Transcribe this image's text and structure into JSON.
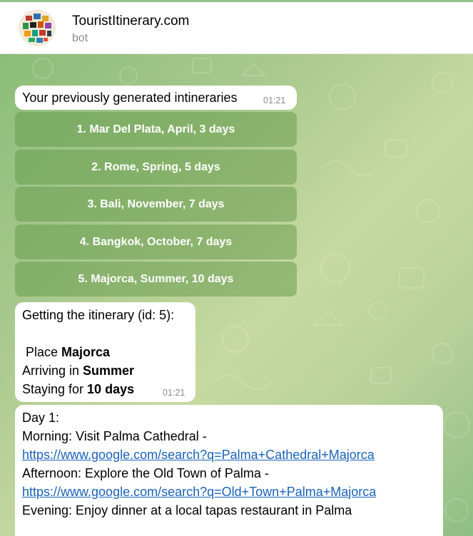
{
  "header": {
    "title": "TouristItinerary.com",
    "subtitle": "bot"
  },
  "messages": {
    "first": {
      "text": "Your previously generated intineraries",
      "time": "01:21"
    },
    "buttons": [
      "1. Mar Del Plata, April, 3 days",
      "2. Rome, Spring, 5 days",
      "3. Bali, November, 7 days",
      "4. Bangkok, October, 7 days",
      "5. Majorca, Summer, 10 days"
    ],
    "itinerary": {
      "heading": "Getting the itinerary (id: 5):",
      "place_label": " Place ",
      "place_value": "Majorca",
      "arriving_label": "Arriving in ",
      "arriving_value": "Summer",
      "staying_label": "Staying for ",
      "staying_value": "10 days",
      "time": "01:21"
    },
    "plan": {
      "day": "Day 1:",
      "morning": "Morning: Visit Palma Cathedral -",
      "morning_link": "https://www.google.com/search?q=Palma+Cathedral+Majorca",
      "afternoon": "Afternoon: Explore the Old Town of Palma -",
      "afternoon_link": "https://www.google.com/search?q=Old+Town+Palma+Majorca",
      "evening": "Evening: Enjoy dinner at a local tapas restaurant in Palma"
    }
  },
  "colors": {
    "link": "#1a62b8",
    "keyboard_button": "#6e9a52",
    "chat_background": "#a9c98e"
  }
}
